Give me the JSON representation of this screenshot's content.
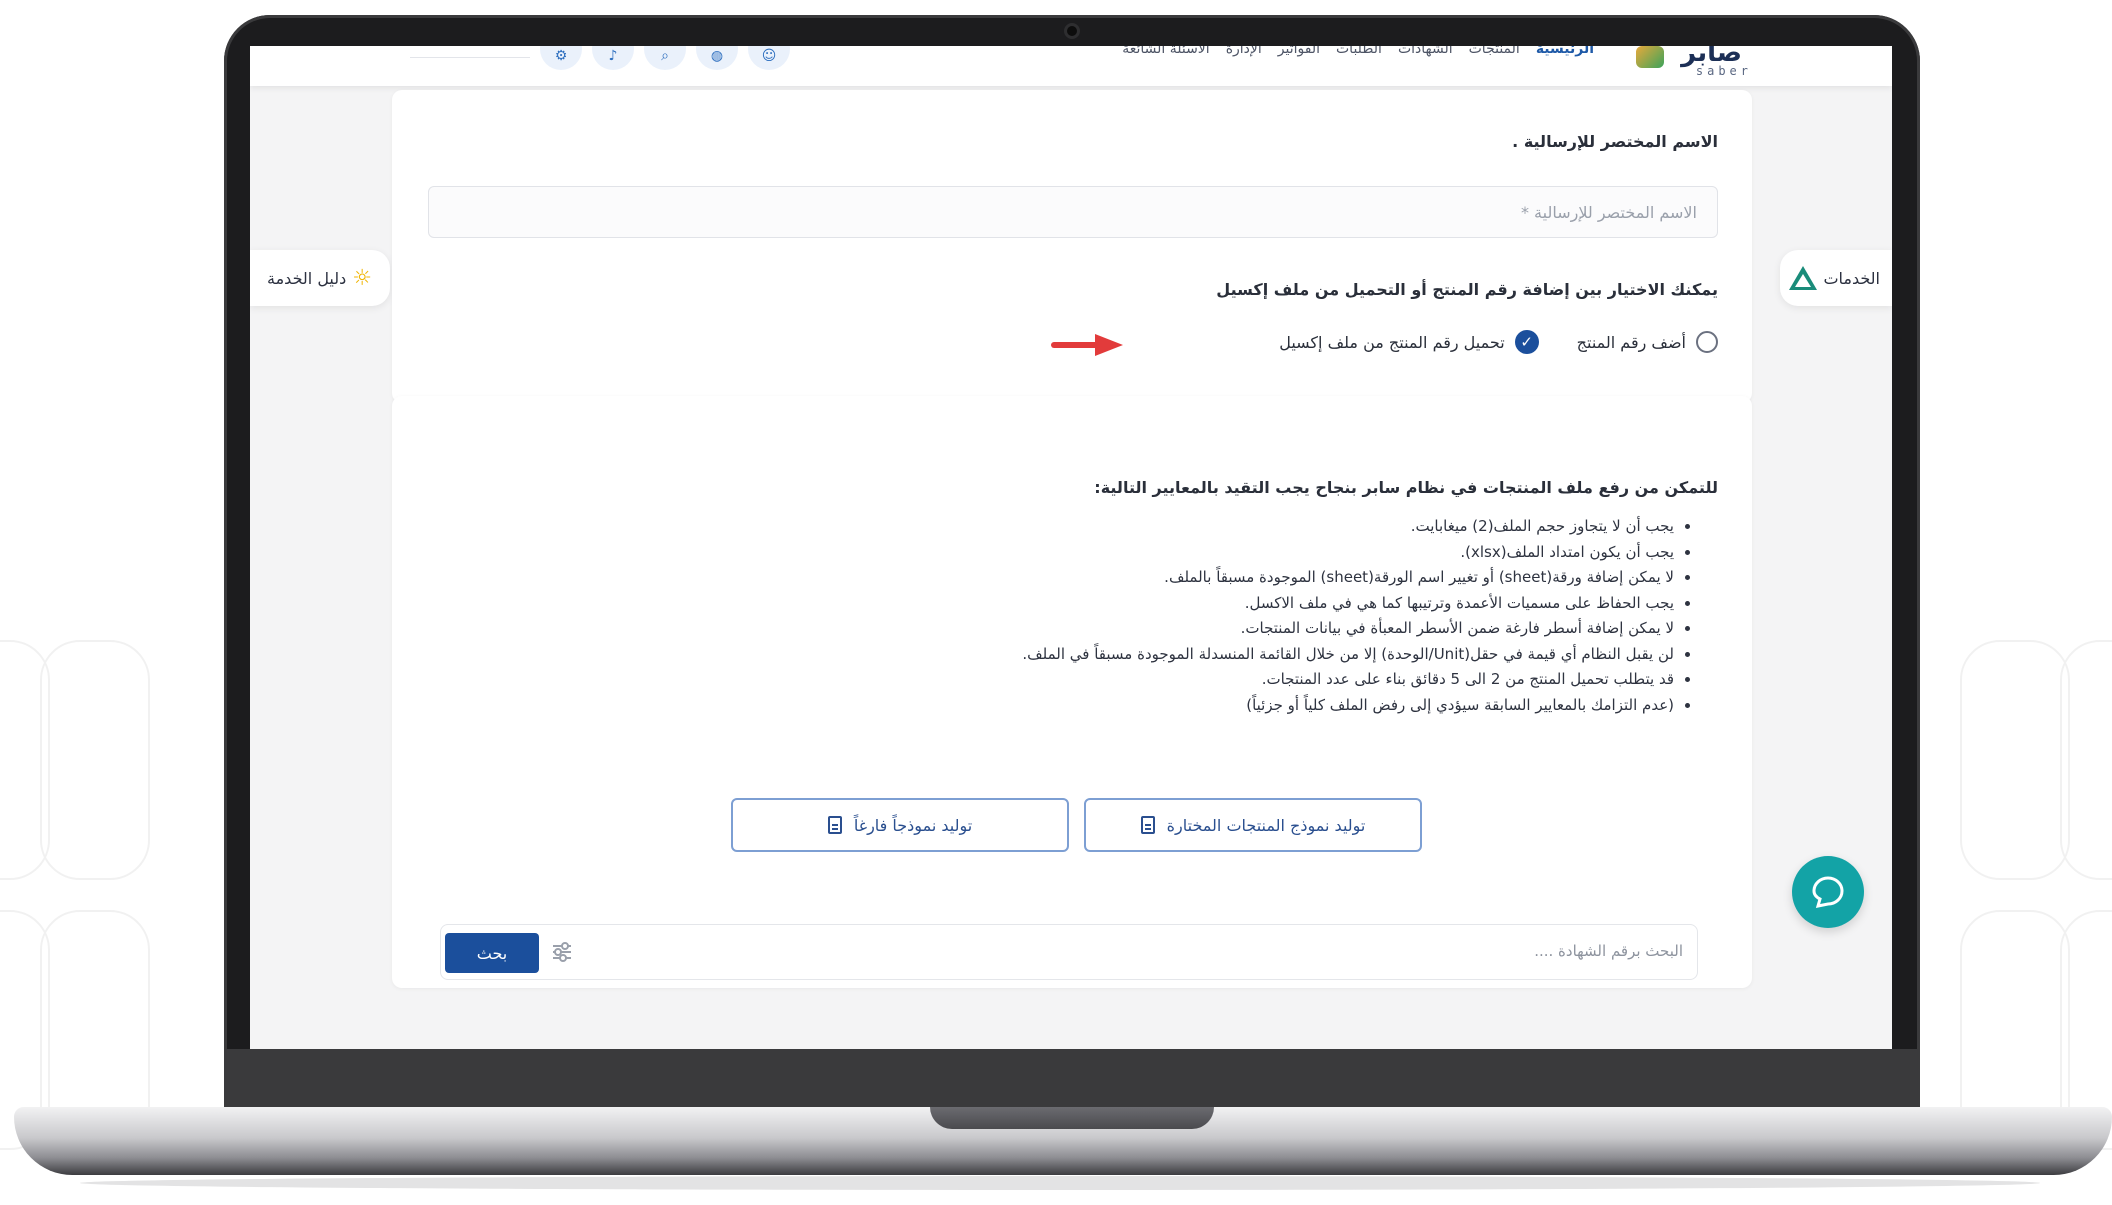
{
  "header": {
    "logo_text": "صابر",
    "logo_latin": "saber",
    "nav": [
      "الرئيسية",
      "المنتجات",
      "الشهادات",
      "الطلبات",
      "الفواتير",
      "الإدارة",
      "الأسئلة الشائعة"
    ],
    "icons": [
      "user-icon",
      "globe-icon",
      "search-icon",
      "bell-icon",
      "settings-icon"
    ]
  },
  "side_tabs": {
    "left": "دليل الخدمة",
    "right": "الخدمات"
  },
  "form": {
    "name_label": "الاسم المختصر للإرسالية .",
    "name_placeholder": "الاسم المختصر للإرسالية *",
    "choice_label": "يمكنك الاختيار بين إضافة رقم المنتج أو التحميل من ملف إكسيل",
    "options": [
      {
        "label": "أضف رقم المنتج",
        "selected": false
      },
      {
        "label": "تحميل رقم المنتج من ملف إكسيل",
        "selected": true
      }
    ]
  },
  "requirements": {
    "title": "للتمكن من رفع ملف المنتجات في نظام سابر بنجاح يجب التقيد بالمعايير التالية:",
    "items": [
      "يجب أن لا يتجاوز حجم الملف(2) ميغابايت.",
      "يجب أن يكون امتداد الملف(xlsx).",
      "لا يمكن إضافة ورقة(sheet) أو تغيير اسم الورقة(sheet) الموجودة مسبقاً بالملف.",
      "يجب الحفاظ على مسميات الأعمدة وترتيبها كما هي في ملف الاكسل.",
      "لا يمكن إضافة أسطر فارغة ضمن الأسطر المعبأة في بيانات المنتجات.",
      "لن يقبل النظام أي قيمة في حقل(Unit/الوحدة) إلا من خلال القائمة المنسدلة الموجودة مسبقاً في الملف.",
      "قد يتطلب تحميل المنتج من 2 الى 5 دقائق بناء على عدد المنتجات.",
      "(عدم التزامك بالمعايير السابقة سيؤدي إلى رفض الملف كلياً أو جزئياً)"
    ]
  },
  "buttons": {
    "generate_selected": "توليد نموذج المنتجات المختارة",
    "generate_empty": "توليد نموذجاً فارغاً",
    "search": "بحث"
  },
  "search": {
    "placeholder": "البحث برقم الشهادة ...."
  },
  "colors": {
    "primary": "#1b4f9c",
    "accent_teal": "#13a3a6",
    "arrow_red": "#e23b3b"
  }
}
